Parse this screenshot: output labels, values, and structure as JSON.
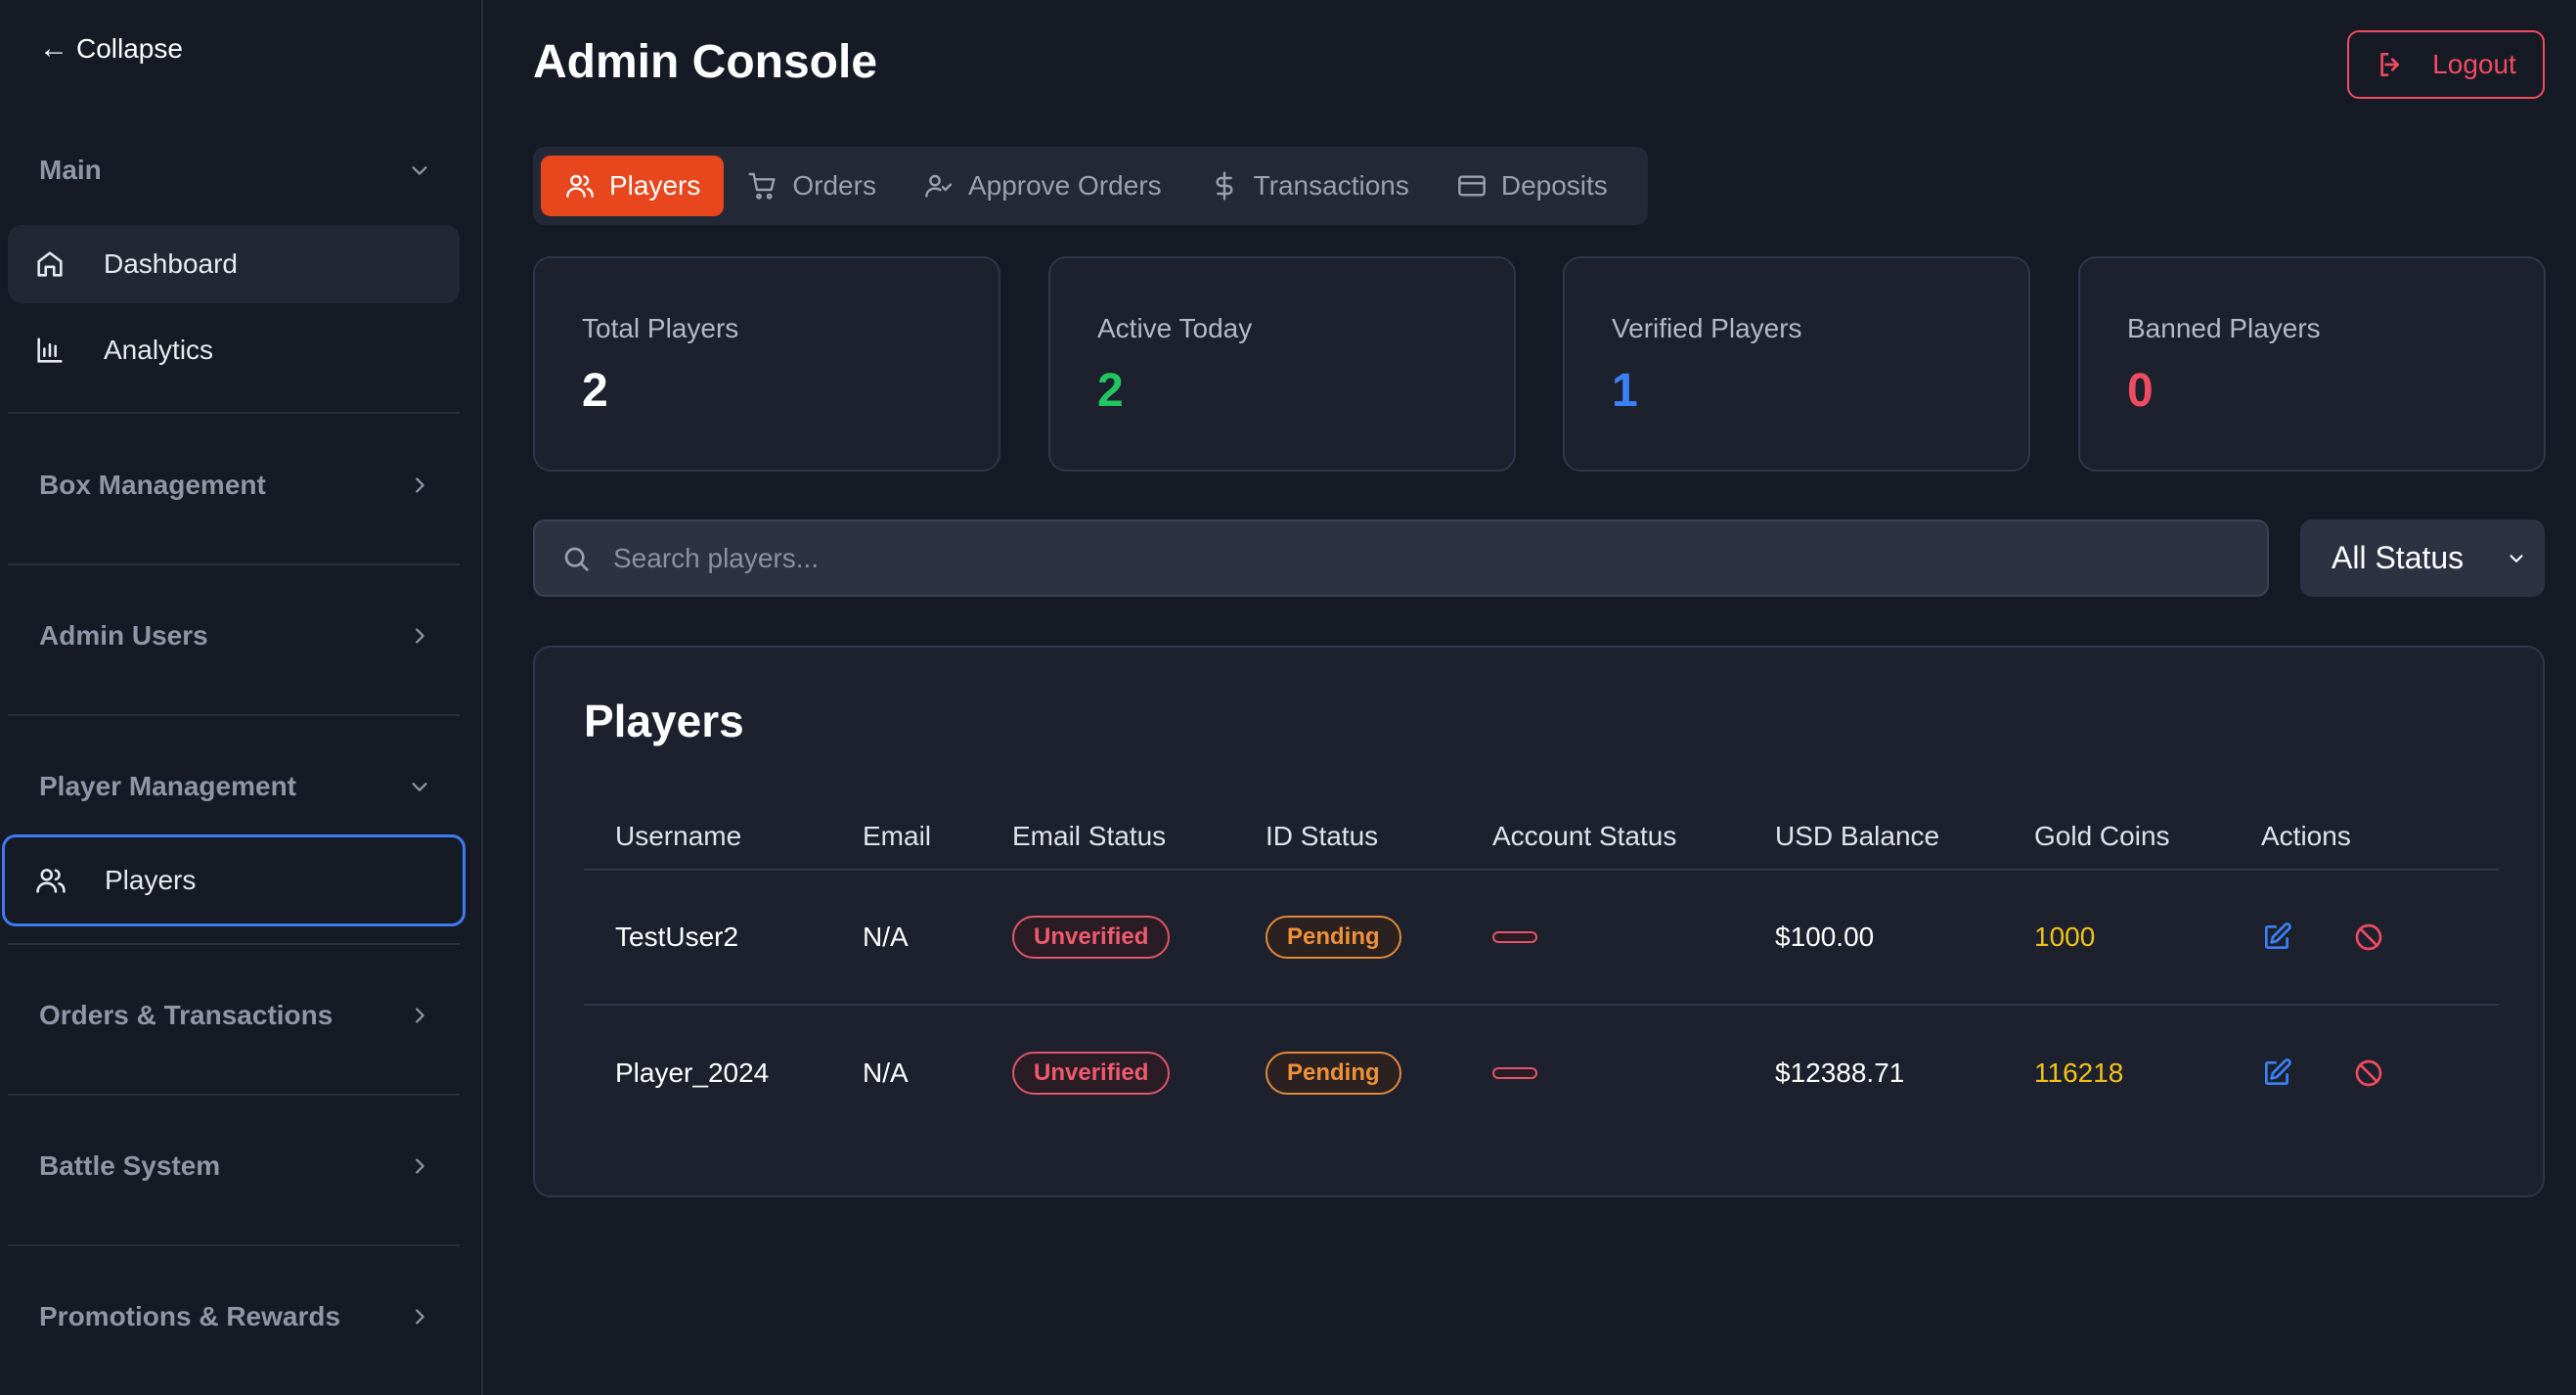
{
  "sidebar": {
    "collapse_label": "Collapse",
    "sections": {
      "main": "Main",
      "box_management": "Box Management",
      "admin_users": "Admin Users",
      "player_management": "Player Management",
      "orders_transactions": "Orders & Transactions",
      "battle_system": "Battle System",
      "promotions_rewards": "Promotions & Rewards"
    },
    "items": {
      "dashboard": "Dashboard",
      "analytics": "Analytics",
      "players": "Players"
    }
  },
  "header": {
    "title": "Admin Console",
    "logout_label": "Logout"
  },
  "tabs": [
    {
      "label": "Players",
      "icon": "users-icon"
    },
    {
      "label": "Orders",
      "icon": "cart-icon"
    },
    {
      "label": "Approve Orders",
      "icon": "user-check-icon"
    },
    {
      "label": "Transactions",
      "icon": "dollar-icon"
    },
    {
      "label": "Deposits",
      "icon": "card-icon"
    }
  ],
  "stats": [
    {
      "label": "Total Players",
      "value": "2",
      "color": "#ffffff"
    },
    {
      "label": "Active Today",
      "value": "2",
      "color": "#22c55e"
    },
    {
      "label": "Verified Players",
      "value": "1",
      "color": "#3b82f6"
    },
    {
      "label": "Banned Players",
      "value": "0",
      "color": "#ef4c62"
    }
  ],
  "search": {
    "placeholder": "Search players..."
  },
  "status_filter": {
    "selected": "All Status"
  },
  "table": {
    "title": "Players",
    "columns": [
      "Username",
      "Email",
      "Email Status",
      "ID Status",
      "Account Status",
      "USD Balance",
      "Gold Coins",
      "Actions"
    ],
    "rows": [
      {
        "username": "TestUser2",
        "email": "N/A",
        "email_status": "Unverified",
        "id_status": "Pending",
        "account_status": "",
        "usd_balance": "$100.00",
        "gold_coins": "1000"
      },
      {
        "username": "Player_2024",
        "email": "N/A",
        "email_status": "Unverified",
        "id_status": "Pending",
        "account_status": "",
        "usd_balance": "$12388.71",
        "gold_coins": "116218"
      }
    ]
  },
  "colors": {
    "accent": "#e8471e",
    "danger": "#ef4c62",
    "active_outline": "#3f7bf0",
    "gold": "#f2c21a",
    "edit": "#3b82f6"
  }
}
